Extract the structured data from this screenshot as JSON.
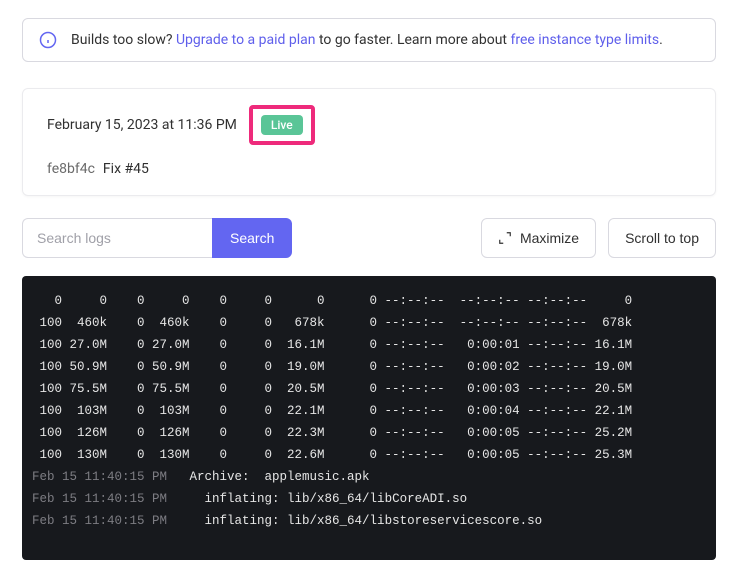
{
  "notice": {
    "prefix": "Builds too slow? ",
    "link1": "Upgrade to a paid plan",
    "mid": " to go faster. Learn more about ",
    "link2": "free instance type limits",
    "suffix": "."
  },
  "build": {
    "date": "February 15, 2023 at 11:36 PM",
    "live": "Live",
    "commit_hash": "fe8bf4c",
    "commit_msg": "Fix #45"
  },
  "controls": {
    "search_placeholder": "Search logs",
    "search_btn": "Search",
    "maximize": "Maximize",
    "scroll_top": "Scroll to top"
  },
  "logs": {
    "download_rows": [
      "   0     0    0     0    0     0      0      0 --:--:--  --:--:-- --:--:--     0",
      " 100  460k    0  460k    0     0   678k      0 --:--:--  --:--:-- --:--:--  678k",
      " 100 27.0M    0 27.0M    0     0  16.1M      0 --:--:--   0:00:01 --:--:-- 16.1M",
      " 100 50.9M    0 50.9M    0     0  19.0M      0 --:--:--   0:00:02 --:--:-- 19.0M",
      " 100 75.5M    0 75.5M    0     0  20.5M      0 --:--:--   0:00:03 --:--:-- 20.5M",
      " 100  103M    0  103M    0     0  22.1M      0 --:--:--   0:00:04 --:--:-- 22.1M",
      " 100  126M    0  126M    0     0  22.3M      0 --:--:--   0:00:05 --:--:-- 25.2M",
      " 100  130M    0  130M    0     0  22.6M      0 --:--:--   0:00:05 --:--:-- 25.3M"
    ],
    "ts_rows": [
      {
        "ts": "Feb 15 11:40:15 PM",
        "msg": "Archive:  applemusic.apk"
      },
      {
        "ts": "Feb 15 11:40:15 PM",
        "msg": "  inflating: lib/x86_64/libCoreADI.so"
      },
      {
        "ts": "Feb 15 11:40:15 PM",
        "msg": "  inflating: lib/x86_64/libstoreservicescore.so"
      }
    ]
  }
}
